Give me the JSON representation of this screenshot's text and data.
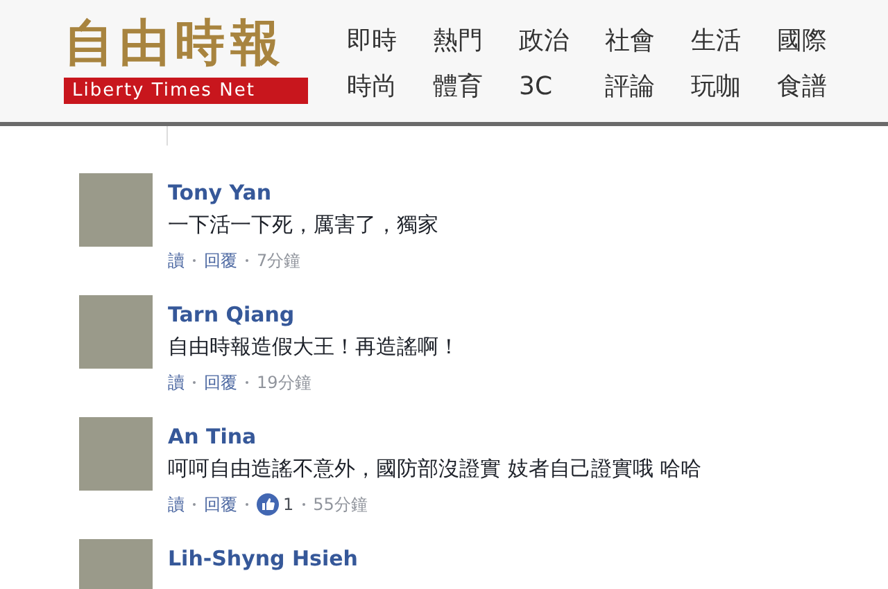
{
  "header": {
    "logo_title": "自由時報",
    "logo_subtitle": "Liberty Times Net",
    "nav_rows": [
      [
        "即時",
        "熱門",
        "政治",
        "社會",
        "生活",
        "國際"
      ],
      [
        "時尚",
        "體育",
        "3C",
        "評論",
        "玩咖",
        "食譜"
      ]
    ]
  },
  "comments": [
    {
      "name": "Tony Yan",
      "text": "一下活一下死，厲害了，獨家",
      "like": "讀",
      "reply": "回覆",
      "time": "7分鐘"
    },
    {
      "name": "Tarn Qiang",
      "text": "自由時報造假大王！再造謠啊！",
      "like": "讀",
      "reply": "回覆",
      "time": "19分鐘"
    },
    {
      "name": "An Tina",
      "text": "呵呵自由造謠不意外，國防部沒證實 妓者自己證實哦 哈哈",
      "like": "讀",
      "reply": "回覆",
      "reactions": "1",
      "time": "55分鐘"
    },
    {
      "name": "Lih-Shyng Hsieh"
    }
  ]
}
